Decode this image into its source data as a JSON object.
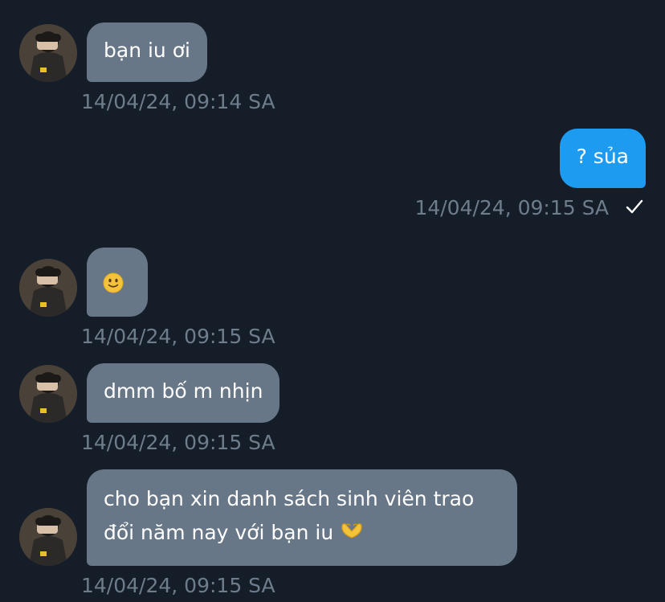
{
  "messages": [
    {
      "side": "in",
      "text": "bạn iu ơi",
      "timestamp": "14/04/24, 09:14 SA"
    },
    {
      "side": "out",
      "text": "? sủa",
      "timestamp": "14/04/24, 09:15 SA",
      "status_icon": "checkmark-icon"
    },
    {
      "side": "in",
      "text": "",
      "emoji": "🙂",
      "timestamp": "14/04/24, 09:15 SA"
    },
    {
      "side": "in",
      "text": "dmm bố m nhịn",
      "timestamp": "14/04/24, 09:15 SA"
    },
    {
      "side": "in",
      "text_line1": "cho bạn xin danh sách sinh viên trao",
      "text_line2": "đổi năm nay với bạn iu",
      "emoji": "🫶",
      "timestamp": "14/04/24, 09:15 SA"
    }
  ],
  "colors": {
    "background": "#151d28",
    "incoming_bubble": "#687787",
    "outgoing_bubble": "#1d9bf0",
    "timestamp": "#6e7d8c"
  }
}
